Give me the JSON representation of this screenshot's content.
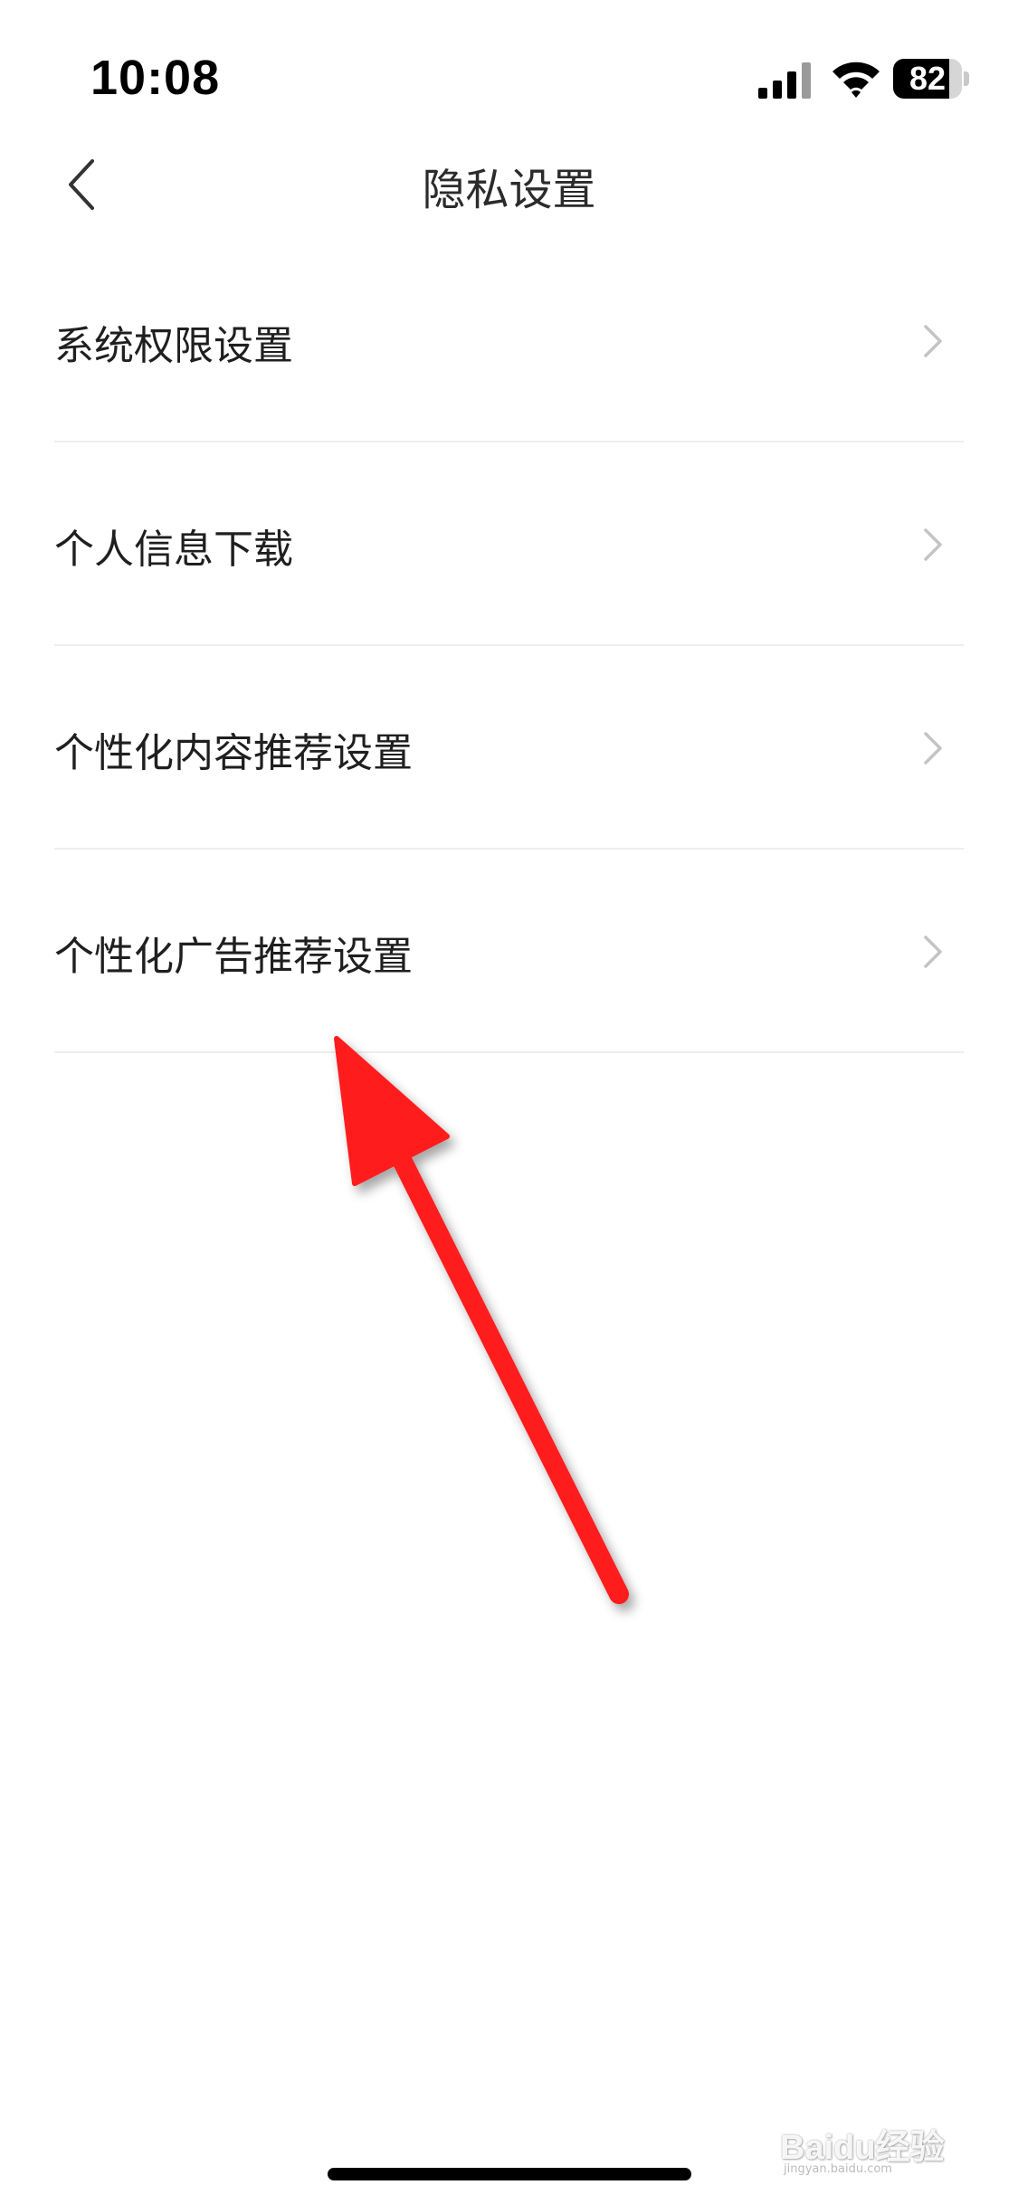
{
  "status_bar": {
    "time": "10:08",
    "battery_level": "82",
    "battery_fraction": 0.82,
    "icons": [
      "signal-icon",
      "wifi-icon",
      "battery-icon"
    ]
  },
  "nav": {
    "title": "隐私设置",
    "back_icon": "chevron-left-icon"
  },
  "settings": {
    "items": [
      {
        "label": "系统权限设置",
        "icon": "chevron-right-icon"
      },
      {
        "label": "个人信息下载",
        "icon": "chevron-right-icon"
      },
      {
        "label": "个性化内容推荐设置",
        "icon": "chevron-right-icon"
      },
      {
        "label": "个性化广告推荐设置",
        "icon": "chevron-right-icon"
      }
    ]
  },
  "annotation": {
    "type": "arrow",
    "color": "#ff1a1a",
    "target": "个性化广告推荐设置"
  },
  "watermark": {
    "text": "Baidu经验",
    "subtext": "jingyan.baidu.com"
  },
  "colors": {
    "background": "#ffffff",
    "text": "#1f1f1f",
    "divider": "#eeeeee",
    "chevron": "#c4c4c4",
    "arrow": "#ff1a1a"
  }
}
